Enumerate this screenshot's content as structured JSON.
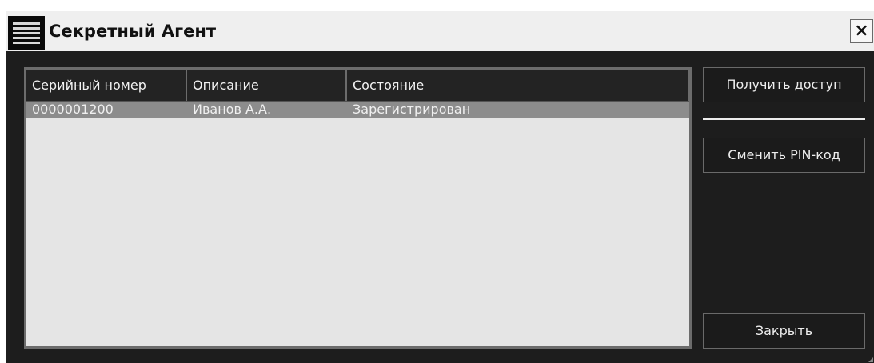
{
  "window": {
    "title": "Секретный Агент",
    "close_label": "×"
  },
  "table": {
    "headers": [
      "Серийный номер",
      "Описание",
      "Состояние"
    ],
    "rows": [
      [
        "0000001200",
        "Иванов А.А.",
        "Зарегистрирован"
      ]
    ]
  },
  "actions": {
    "get_access": "Получить доступ",
    "change_pin": "Сменить PIN-код",
    "close": "Закрыть"
  },
  "colors": {
    "window_bg": "#1d1d1d",
    "titlebar_bg": "#efefef",
    "table_bg": "#e5e5e5",
    "selected_row": "#8c8c8c"
  }
}
